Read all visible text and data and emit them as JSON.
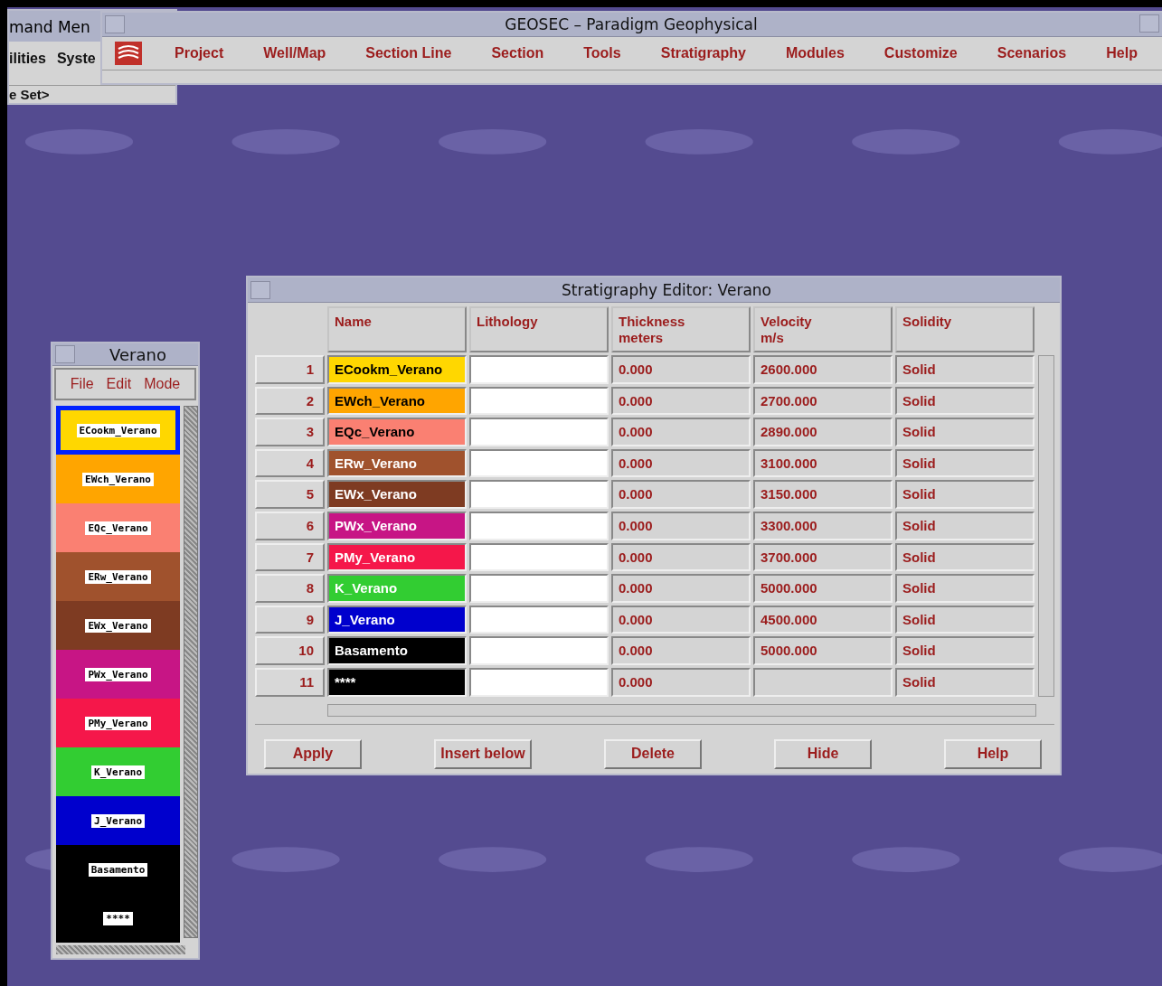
{
  "command_window": {
    "title": "mand Men",
    "menu": [
      "ilities",
      "Syste"
    ],
    "field": "e Set>"
  },
  "main_window": {
    "title": "GEOSEC – Paradigm Geophysical",
    "menu": [
      "Project",
      "Well/Map",
      "Section Line",
      "Section",
      "Tools",
      "Stratigraphy",
      "Modules",
      "Customize",
      "Scenarios",
      "Help"
    ]
  },
  "layer_window": {
    "title": "Verano",
    "menu": [
      "File",
      "Edit",
      "Mode"
    ],
    "layers": [
      {
        "name": "ECookm_Verano",
        "color": "#ffd700",
        "selected": true
      },
      {
        "name": "EWch_Verano",
        "color": "#ffa500",
        "selected": false
      },
      {
        "name": "EQc_Verano",
        "color": "#fa8072",
        "selected": false
      },
      {
        "name": "ERw_Verano",
        "color": "#a0522d",
        "selected": false
      },
      {
        "name": "EWx_Verano",
        "color": "#7e3b22",
        "selected": false
      },
      {
        "name": "PWx_Verano",
        "color": "#c71585",
        "selected": false
      },
      {
        "name": "PMy_Verano",
        "color": "#f5174a",
        "selected": false
      },
      {
        "name": "K_Verano",
        "color": "#32cd32",
        "selected": false
      },
      {
        "name": "J_Verano",
        "color": "#0000cd",
        "selected": false
      },
      {
        "name": "Basamento",
        "color": "#000000",
        "selected": false
      },
      {
        "name": "****",
        "color": "#000000",
        "selected": false
      }
    ]
  },
  "editor": {
    "title": "Stratigraphy Editor: Verano",
    "columns": [
      "Name",
      "Lithology",
      "Thickness\nmeters",
      "Velocity\nm/s",
      "Solidity"
    ],
    "rows": [
      {
        "number": "1",
        "name": "ECookm_Verano",
        "color": "#ffd700",
        "thickness": "0.000",
        "velocity": "2600.000",
        "solidity": "Solid"
      },
      {
        "number": "2",
        "name": "EWch_Verano",
        "color": "#ffa500",
        "thickness": "0.000",
        "velocity": "2700.000",
        "solidity": "Solid"
      },
      {
        "number": "3",
        "name": "EQc_Verano",
        "color": "#fa8072",
        "thickness": "0.000",
        "velocity": "2890.000",
        "solidity": "Solid"
      },
      {
        "number": "4",
        "name": "ERw_Verano",
        "color": "#a0522d",
        "thickness": "0.000",
        "velocity": "3100.000",
        "solidity": "Solid"
      },
      {
        "number": "5",
        "name": "EWx_Verano",
        "color": "#7e3b22",
        "thickness": "0.000",
        "velocity": "3150.000",
        "solidity": "Solid"
      },
      {
        "number": "6",
        "name": "PWx_Verano",
        "color": "#c71585",
        "thickness": "0.000",
        "velocity": "3300.000",
        "solidity": "Solid"
      },
      {
        "number": "7",
        "name": "PMy_Verano",
        "color": "#f5174a",
        "thickness": "0.000",
        "velocity": "3700.000",
        "solidity": "Solid"
      },
      {
        "number": "8",
        "name": "K_Verano",
        "color": "#32cd32",
        "thickness": "0.000",
        "velocity": "5000.000",
        "solidity": "Solid"
      },
      {
        "number": "9",
        "name": "J_Verano",
        "color": "#0000cd",
        "thickness": "0.000",
        "velocity": "4500.000",
        "solidity": "Solid"
      },
      {
        "number": "10",
        "name": "Basamento",
        "color": "#000000",
        "thickness": "0.000",
        "velocity": "5000.000",
        "solidity": "Solid"
      },
      {
        "number": "11",
        "name": "****",
        "color": "#000000",
        "thickness": "0.000",
        "solidity": "Solid"
      }
    ],
    "buttons": [
      "Apply",
      "Insert below",
      "Delete",
      "Hide",
      "Help"
    ]
  }
}
